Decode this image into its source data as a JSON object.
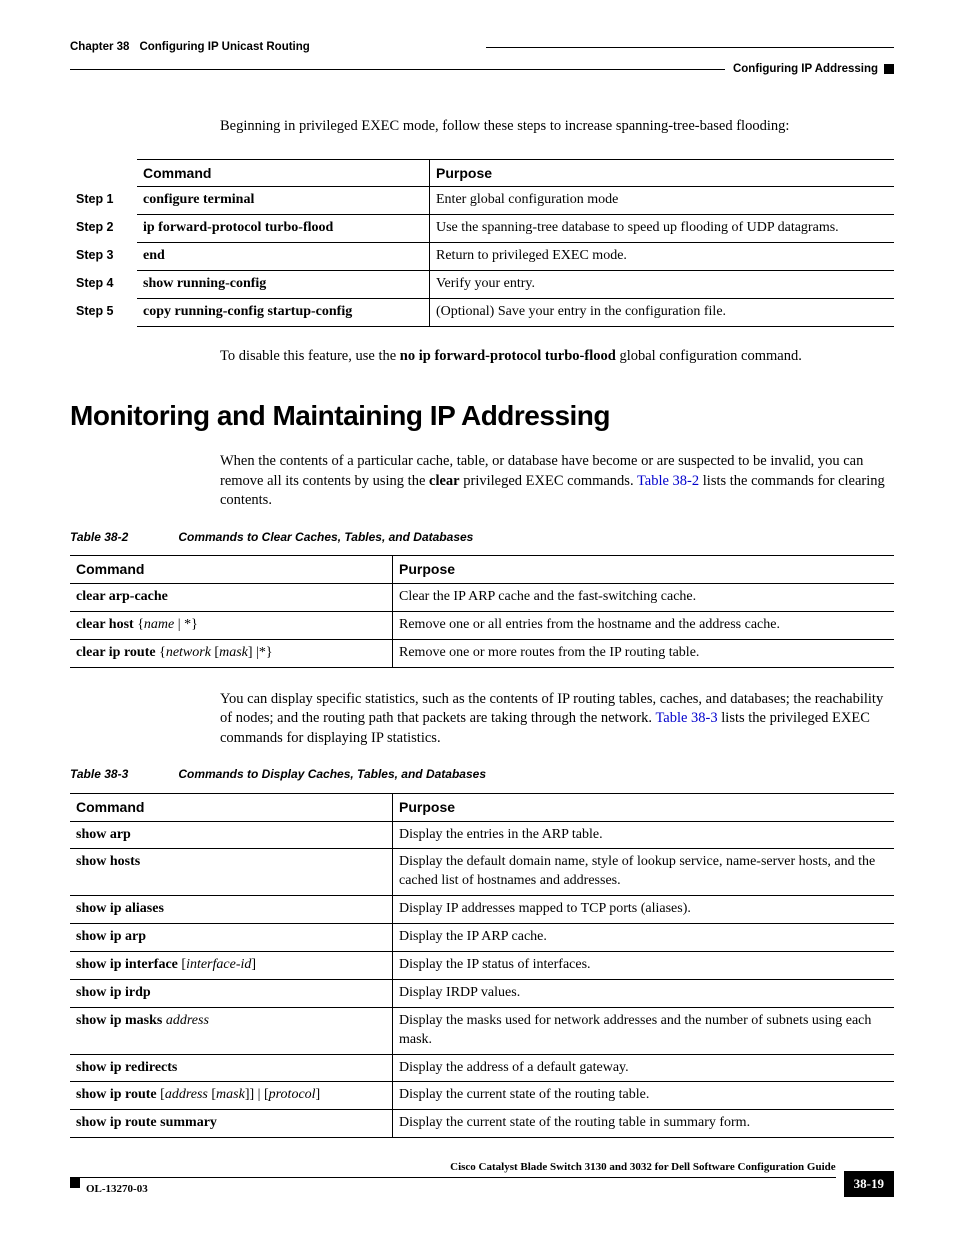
{
  "header": {
    "chapter": "Chapter 38",
    "title": "Configuring IP Unicast Routing",
    "section": "Configuring IP Addressing"
  },
  "intro": "Beginning in privileged EXEC mode, follow these steps to increase spanning-tree-based flooding:",
  "steps_header": {
    "command": "Command",
    "purpose": "Purpose"
  },
  "steps": [
    {
      "label": "Step 1",
      "command": "configure terminal",
      "purpose": "Enter global configuration mode"
    },
    {
      "label": "Step 2",
      "command": "ip forward-protocol turbo-flood",
      "purpose": "Use the spanning-tree database to speed up flooding of UDP datagrams."
    },
    {
      "label": "Step 3",
      "command": "end",
      "purpose": "Return to privileged EXEC mode."
    },
    {
      "label": "Step 4",
      "command": "show running-config",
      "purpose": "Verify your entry."
    },
    {
      "label": "Step 5",
      "command": "copy running-config startup-config",
      "purpose": "(Optional) Save your entry in the configuration file."
    }
  ],
  "disable_note": {
    "pre": "To disable this feature, use the ",
    "cmd": "no ip forward-protocol turbo-flood",
    "post": " global configuration command."
  },
  "section_heading": "Monitoring and Maintaining IP Addressing",
  "para1": {
    "pre": "When the contents of a particular cache, table, or database have become or are suspected to be invalid, you can remove all its contents by using the ",
    "bold": "clear",
    "mid": " privileged EXEC commands. ",
    "link": "Table 38-2",
    "post": " lists the commands for clearing contents."
  },
  "table2_caption": {
    "num": "Table 38-2",
    "title": "Commands to Clear Caches, Tables, and Databases"
  },
  "table2_header": {
    "command": "Command",
    "purpose": "Purpose"
  },
  "table2_rows": [
    {
      "cmd_bold": "clear arp-cache",
      "cmd_ital": "",
      "brace": "",
      "purpose": "Clear the IP ARP cache and the fast-switching cache."
    },
    {
      "cmd_bold": "clear host",
      "cmd_ital": "name",
      "brace": "both",
      "alt": "*",
      "purpose": "Remove one or all entries from the hostname and the address cache."
    },
    {
      "cmd_bold": "clear ip route",
      "cmd_ital": "network",
      "cmd_ital2": "mask",
      "brace": "nested",
      "alt": "*",
      "purpose": "Remove one or more routes from the IP routing table."
    }
  ],
  "para2": {
    "pre": "You can display specific statistics, such as the contents of IP routing tables, caches, and databases; the reachability of nodes; and the routing path that packets are taking through the network. ",
    "link": "Table 38-3",
    "post": " lists the privileged EXEC commands for displaying IP statistics."
  },
  "table3_caption": {
    "num": "Table 38-3",
    "title": "Commands to Display Caches, Tables, and Databases"
  },
  "table3_header": {
    "command": "Command",
    "purpose": "Purpose"
  },
  "table3_rows_simple": [
    {
      "cmd": "show arp",
      "purpose": "Display the entries in the ARP table."
    },
    {
      "cmd": "show hosts",
      "purpose": "Display the default domain name, style of lookup service, name-server hosts, and the cached list of hostnames and addresses."
    },
    {
      "cmd": "show ip aliases",
      "purpose": "Display IP addresses mapped to TCP ports (aliases)."
    },
    {
      "cmd": "show ip arp",
      "purpose": "Display the IP ARP cache."
    }
  ],
  "table3_row_interface": {
    "cmd": "show ip interface",
    "ital": "interface-id",
    "purpose": "Display the IP status of interfaces."
  },
  "table3_row_irdp": {
    "cmd": "show ip irdp",
    "purpose": "Display IRDP values."
  },
  "table3_row_masks": {
    "cmd": "show ip masks",
    "ital": "address",
    "purpose": "Display the masks used for network addresses and the number of subnets using each mask."
  },
  "table3_row_redirects": {
    "cmd": "show ip redirects",
    "purpose": "Display the address of a default gateway."
  },
  "table3_row_route": {
    "cmd": "show ip route",
    "ital1": "address",
    "ital2": "mask",
    "ital3": "protocol",
    "purpose": "Display the current state of the routing table."
  },
  "table3_row_summary": {
    "cmd": "show ip route summary",
    "purpose": "Display the current state of the routing table in summary form."
  },
  "footer": {
    "guide": "Cisco Catalyst Blade Switch 3130 and 3032 for Dell Software Configuration Guide",
    "doc": "OL-13270-03",
    "page": "38-19"
  }
}
